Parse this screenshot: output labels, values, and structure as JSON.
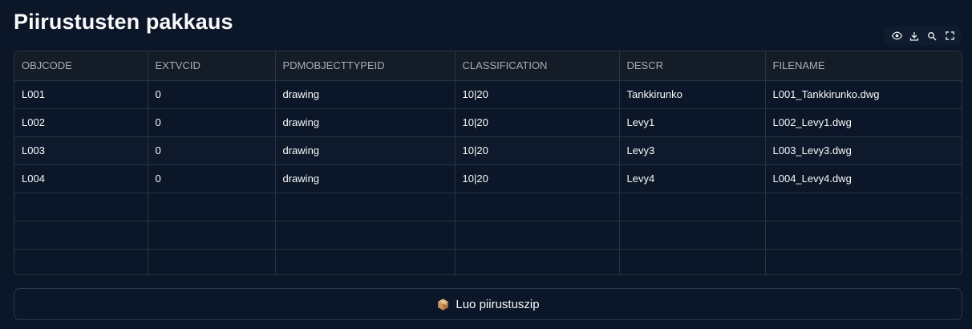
{
  "header": {
    "title": "Piirustusten pakkaus"
  },
  "toolbar": {
    "icons": [
      "eye-icon",
      "download-icon",
      "search-icon",
      "fullscreen-icon"
    ]
  },
  "table": {
    "columns": [
      "OBJCODE",
      "EXTVCID",
      "PDMOBJECTTYPEID",
      "CLASSIFICATION",
      "DESCR",
      "FILENAME"
    ],
    "rows": [
      [
        "L001",
        "0",
        "drawing",
        "10|20",
        "Tankkirunko",
        "L001_Tankkirunko.dwg"
      ],
      [
        "L002",
        "0",
        "drawing",
        "10|20",
        "Levy1",
        "L002_Levy1.dwg"
      ],
      [
        "L003",
        "0",
        "drawing",
        "10|20",
        "Levy3",
        "L003_Levy3.dwg"
      ],
      [
        "L004",
        "0",
        "drawing",
        "10|20",
        "Levy4",
        "L004_Levy4.dwg"
      ]
    ]
  },
  "action_button": {
    "icon": "package-icon",
    "label": "Luo piirustuszip"
  },
  "colors": {
    "background": "#0b1628",
    "header_row": "#141c28",
    "grid_line": "#283444",
    "text": "#fafafa"
  }
}
